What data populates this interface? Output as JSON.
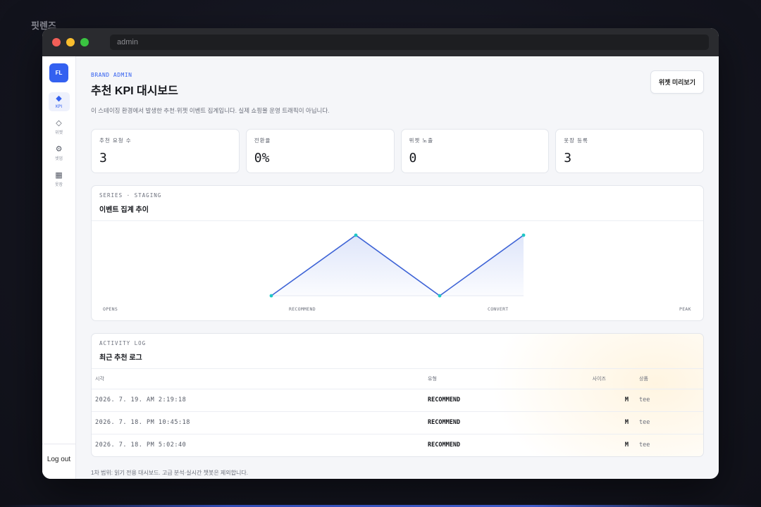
{
  "brand_mark": "핏렌즈",
  "browser": {
    "url": "admin"
  },
  "sidebar": {
    "logo": "FL",
    "items": [
      {
        "icon": "diamond-filled-icon",
        "glyph": "◆",
        "label": "KPI",
        "active": true
      },
      {
        "icon": "diamond-outline-icon",
        "glyph": "◇",
        "label": "위젯",
        "active": false
      },
      {
        "icon": "gear-icon",
        "glyph": "⚙",
        "label": "셋업",
        "active": false
      },
      {
        "icon": "grid-icon",
        "glyph": "▦",
        "label": "옷장",
        "active": false
      }
    ],
    "logout": "Log out"
  },
  "header": {
    "eyebrow": "BRAND ADMIN",
    "title": "추천 KPI 대시보드",
    "subtitle": "이 스테이징 환경에서 발생한 추천·위젯 이벤트 집계입니다. 실제 쇼핑몰 운영 트래픽이 아닙니다.",
    "preview_button": "위젯 미리보기"
  },
  "kpis": [
    {
      "label": "추천 요청 수",
      "value": "3"
    },
    {
      "label": "전환율",
      "value": "0%"
    },
    {
      "label": "위젯 노출",
      "value": "0"
    },
    {
      "label": "옷장 등록",
      "value": "3"
    }
  ],
  "series_card": {
    "eyebrow": "SERIES · STAGING",
    "title": "이벤트 집계 추이"
  },
  "chart_data": {
    "type": "area",
    "categories": [
      "OPENS",
      "RECOMMEND",
      "CONVERT",
      "PEAK"
    ],
    "values": [
      0,
      3,
      0,
      3
    ],
    "ylim": [
      0,
      3
    ],
    "grid": false,
    "line_color": "#3d63d6",
    "point_color": "#1fc7c7"
  },
  "log_card": {
    "eyebrow": "ACTIVITY LOG",
    "title": "최근 추천 로그",
    "columns": [
      "시각",
      "유형",
      "사이즈",
      "상품"
    ],
    "rows": [
      {
        "time": "2026. 7. 19. AM 2:19:18",
        "type": "RECOMMEND",
        "size": "M",
        "product": "tee"
      },
      {
        "time": "2026. 7. 18. PM 10:45:18",
        "type": "RECOMMEND",
        "size": "M",
        "product": "tee"
      },
      {
        "time": "2026. 7. 18. PM 5:02:40",
        "type": "RECOMMEND",
        "size": "M",
        "product": "tee"
      }
    ]
  },
  "footnote": "1차 범위: 읽기 전용 대시보드. 고급 분석·실시간 챗봇은 제외합니다.",
  "colors": {
    "accent": "#3461f0",
    "window_bg": "#f5f6f9"
  }
}
